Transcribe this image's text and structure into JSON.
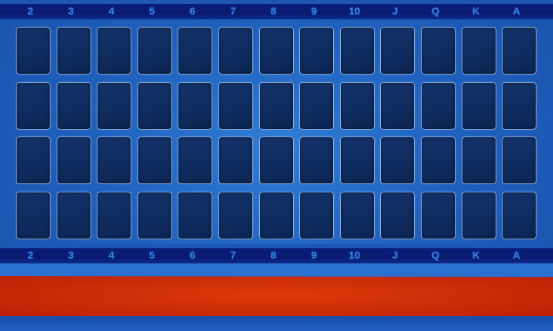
{
  "board": {
    "ranks": [
      "2",
      "3",
      "4",
      "5",
      "6",
      "7",
      "8",
      "9",
      "10",
      "J",
      "Q",
      "K",
      "A"
    ],
    "rows": 4,
    "colors": {
      "background": "#1f62bf",
      "rank_text": "#2e82e0",
      "slot_fill": "#12306a",
      "slot_border": "#8fb0da",
      "red_strip": "#cc2a08"
    }
  }
}
